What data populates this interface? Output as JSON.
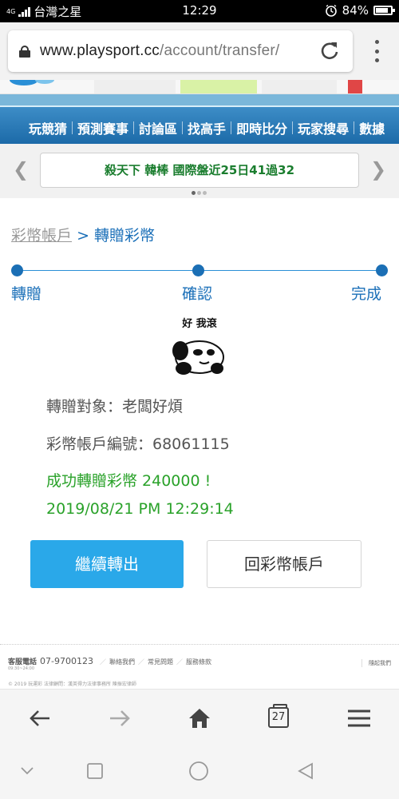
{
  "status_bar": {
    "network": "4G",
    "carrier": "台灣之星",
    "time": "12:29",
    "battery": "84%",
    "battery_level": 0.84
  },
  "browser": {
    "url_host": "www.playsport.cc",
    "url_path": "/account/transfer/",
    "tab_count": "27"
  },
  "site_nav": {
    "items": [
      "玩競猜",
      "預測賽事",
      "討論區",
      "找高手",
      "即時比分",
      "玩家搜尋",
      "數據"
    ]
  },
  "ticker": {
    "prefix": "殺天下",
    "sport": "韓棒",
    "text": "國際盤近25日41過32"
  },
  "breadcrumb": {
    "parent": "彩幣帳戶",
    "separator": ">",
    "current": "轉贈彩幣"
  },
  "steps": [
    {
      "label": "轉贈"
    },
    {
      "label": "確認"
    },
    {
      "label": "完成"
    }
  ],
  "sticker": {
    "caption": "好 我滾"
  },
  "transfer": {
    "recipient_line": "轉贈對象：老闆好煩",
    "account_line": "彩幣帳戶編號：68061115",
    "success_line": "成功轉贈彩幣 240000 !",
    "timestamp": "2019/08/21 PM 12:29:14"
  },
  "buttons": {
    "continue": "繼續轉出",
    "back_to_account": "回彩幣帳戶"
  },
  "footer": {
    "phone_label": "客服電話",
    "phone": "07-9700123",
    "hours": "09:30~24:00",
    "links": [
      "聯絡我們",
      "常見問題",
      "服務條款"
    ],
    "bookmark": "隨起我們",
    "copyright": "© 2019 玩運彩 法律顧問：漢英得力法律事務所 陳振宏律師"
  },
  "colors": {
    "link_blue": "#1a6fb8",
    "success_green": "#2aa22a",
    "primary_button": "#2aa8e9",
    "nav_blue": "#1c6aa8"
  }
}
